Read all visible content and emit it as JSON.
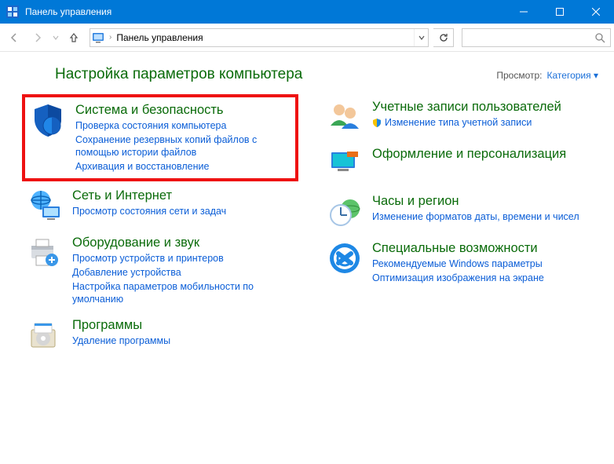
{
  "window": {
    "title": "Панель управления"
  },
  "address": {
    "crumb": "Панель управления"
  },
  "heading": "Настройка параметров компьютера",
  "view": {
    "label": "Просмотр:",
    "value": "Категория"
  },
  "categories": {
    "system_security": {
      "title": "Система и безопасность",
      "links": [
        "Проверка состояния компьютера",
        "Сохранение резервных копий файлов с помощью истории файлов",
        "Архивация и восстановление"
      ]
    },
    "network": {
      "title": "Сеть и Интернет",
      "links": [
        "Просмотр состояния сети и задач"
      ]
    },
    "hardware": {
      "title": "Оборудование и звук",
      "links": [
        "Просмотр устройств и принтеров",
        "Добавление устройства",
        "Настройка параметров мобильности по умолчанию"
      ]
    },
    "programs": {
      "title": "Программы",
      "links": [
        "Удаление программы"
      ]
    },
    "accounts": {
      "title": "Учетные записи пользователей",
      "links": [
        "Изменение типа учетной записи"
      ]
    },
    "personalization": {
      "title": "Оформление и персонализация"
    },
    "clock_region": {
      "title": "Часы и регион",
      "links": [
        "Изменение форматов даты, времени и чисел"
      ]
    },
    "ease_of_access": {
      "title": "Специальные возможности",
      "links": [
        "Рекомендуемые Windows параметры",
        "Оптимизация изображения на экране"
      ]
    }
  }
}
